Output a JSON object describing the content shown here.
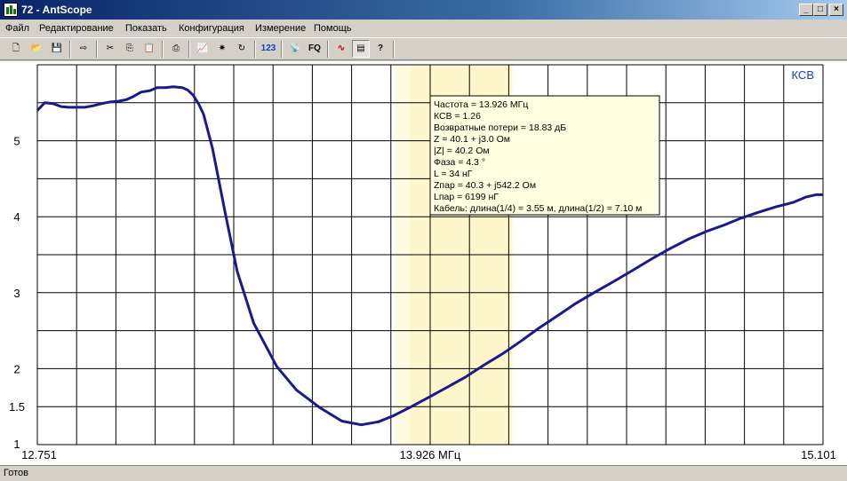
{
  "window": {
    "title": "72 - AntScope",
    "minimize_label": "_",
    "maximize_label": "□",
    "close_label": "×"
  },
  "menu": {
    "items": [
      "Файл",
      "Редактирование",
      "Показать",
      "Конфигурация",
      "Измерение",
      "Помощь"
    ]
  },
  "toolbar": {
    "buttons": [
      {
        "name": "new-file-icon",
        "glyph": "🗋"
      },
      {
        "name": "open-folder-icon",
        "glyph": "📂"
      },
      {
        "name": "save-icon",
        "glyph": "💾"
      },
      {
        "name": "export-icon",
        "glyph": "⇨"
      },
      {
        "name": "cut-icon",
        "glyph": "✂"
      },
      {
        "name": "copy-icon",
        "glyph": "⎘"
      },
      {
        "name": "paste-icon",
        "glyph": "📋"
      },
      {
        "name": "print-icon",
        "glyph": "⎙"
      },
      {
        "name": "chart-icon",
        "glyph": "📈"
      },
      {
        "name": "scan-icon",
        "glyph": "✷"
      },
      {
        "name": "refresh-icon",
        "glyph": "↻"
      },
      {
        "name": "number-format-icon",
        "glyph": "123"
      },
      {
        "name": "antenna-icon",
        "glyph": "📡"
      },
      {
        "name": "frequency-icon",
        "glyph": "FQ"
      },
      {
        "name": "curves-icon",
        "glyph": "∿"
      },
      {
        "name": "data-table-icon",
        "glyph": "▤"
      },
      {
        "name": "help-icon",
        "glyph": "?"
      }
    ]
  },
  "colors": {
    "curve": "#1a1a8c",
    "highlight_band": "#fffbe0",
    "highlight_center": "#fff7cc",
    "tooltip_bg": "#ffffe1",
    "param_label": "#1a3cc8",
    "grid": "#000000"
  },
  "chart_data": {
    "type": "line",
    "parameter_label": "КСВ",
    "x_tick_labels": [
      "12.751",
      "13.926 МГц",
      "15.101"
    ],
    "x_range": [
      12.751,
      15.101
    ],
    "x_center": 13.926,
    "x_unit": "МГц",
    "y_tick_labels": [
      "1",
      "1.5",
      "2",
      "3",
      "4",
      "5"
    ],
    "y_range": [
      1,
      6
    ],
    "highlight_band": [
      13.823,
      14.172
    ],
    "highlight_center_band": [
      13.865,
      14.172
    ],
    "series": [
      {
        "x": [
          12.751,
          12.773,
          12.798,
          12.822,
          12.845,
          12.87,
          12.893,
          12.918,
          12.944,
          12.969,
          12.992,
          13.017,
          13.037,
          13.061,
          13.088,
          13.109,
          13.134,
          13.158,
          13.184,
          13.2,
          13.217,
          13.234,
          13.248,
          13.275,
          13.313,
          13.349,
          13.398,
          13.467,
          13.526,
          13.595,
          13.662,
          13.72,
          13.771,
          13.816,
          13.87,
          13.925,
          13.979,
          14.032,
          14.088,
          14.144,
          14.2,
          14.25,
          14.305,
          14.362,
          14.416,
          14.472,
          14.53,
          14.587,
          14.643,
          14.701,
          14.754,
          14.805,
          14.855,
          14.909,
          14.96,
          15.013,
          15.051,
          15.08,
          15.101
        ],
        "y": [
          5.4,
          5.5,
          5.49,
          5.45,
          5.44,
          5.44,
          5.44,
          5.46,
          5.49,
          5.51,
          5.52,
          5.54,
          5.58,
          5.64,
          5.66,
          5.7,
          5.7,
          5.71,
          5.7,
          5.67,
          5.6,
          5.48,
          5.35,
          4.9,
          4.05,
          3.28,
          2.6,
          2.03,
          1.72,
          1.49,
          1.31,
          1.26,
          1.3,
          1.38,
          1.5,
          1.63,
          1.76,
          1.89,
          2.05,
          2.2,
          2.37,
          2.53,
          2.69,
          2.86,
          3.0,
          3.14,
          3.29,
          3.44,
          3.58,
          3.71,
          3.81,
          3.89,
          3.98,
          4.06,
          4.13,
          4.19,
          4.26,
          4.29,
          4.29
        ]
      }
    ]
  },
  "tooltip": {
    "lines": [
      "Частота = 13.926 МГц",
      "КСВ = 1.26",
      "Возвратные потери = 18.83 дБ",
      "Z = 40.1 + j3.0 Ом",
      "|Z| = 40.2 Ом",
      "Фаза = 4.3 °",
      "L = 34 нГ",
      "Zпар = 40.3 + j542.2 Ом",
      "Lпар = 6199 нГ",
      "Кабель: длина(1/4) = 3.55 м, длина(1/2) = 7.10 м"
    ]
  },
  "status": {
    "text": "Готов"
  }
}
